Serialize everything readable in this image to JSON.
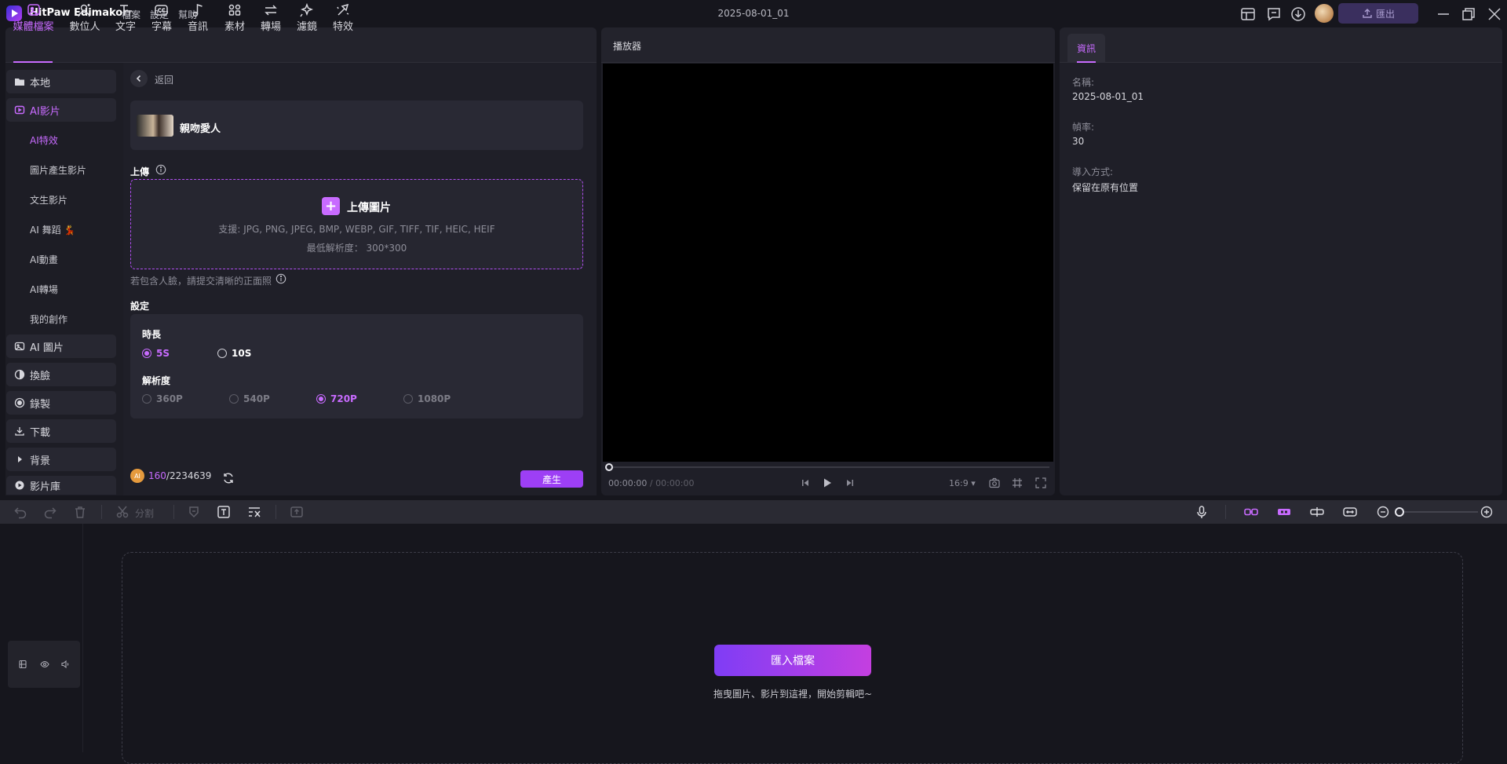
{
  "titlebar": {
    "app_name": "HitPaw Edimakor",
    "menus": [
      "檔案",
      "設定",
      "幫助"
    ],
    "project_title": "2025-08-01_01",
    "export_label": "匯出"
  },
  "toolbar": {
    "tabs": [
      {
        "label": "媒體檔案",
        "icon": "media-icon",
        "active": true
      },
      {
        "label": "數位人",
        "icon": "avatar-person-icon"
      },
      {
        "label": "文字",
        "icon": "text-icon"
      },
      {
        "label": "字幕",
        "icon": "subtitle-icon"
      },
      {
        "label": "音訊",
        "icon": "music-note-icon"
      },
      {
        "label": "素材",
        "icon": "assets-icon"
      },
      {
        "label": "轉場",
        "icon": "transition-icon"
      },
      {
        "label": "濾鏡",
        "icon": "filter-icon"
      },
      {
        "label": "特效",
        "icon": "effects-icon"
      }
    ]
  },
  "sidebar": {
    "items": [
      {
        "label": "本地",
        "icon": "folder-icon"
      },
      {
        "label": "AI影片",
        "icon": "ai-video-icon",
        "active": true
      },
      {
        "label": "AI 圖片",
        "icon": "ai-image-icon"
      },
      {
        "label": "換臉",
        "icon": "face-swap-icon"
      },
      {
        "label": "錄製",
        "icon": "record-icon"
      },
      {
        "label": "下載",
        "icon": "download-icon"
      },
      {
        "label": "背景",
        "icon": "caret-right-icon"
      },
      {
        "label": "影片庫",
        "icon": "video-library-icon"
      }
    ],
    "sub_items": [
      {
        "label": "AI特效",
        "active": true
      },
      {
        "label": "圖片產生影片"
      },
      {
        "label": "文生影片"
      },
      {
        "label": "AI 舞蹈 💃"
      },
      {
        "label": "AI動畫"
      },
      {
        "label": "AI轉場"
      },
      {
        "label": "我的創作"
      }
    ]
  },
  "content": {
    "back_label": "返回",
    "effect_name": "親吻愛人",
    "upload_heading": "上傳",
    "upload_button": "上傳圖片",
    "upload_formats": "支援: JPG, PNG, JPEG, BMP, WEBP, GIF, TIFF, TIF, HEIC, HEIF",
    "upload_min_res": "最低解析度： 300*300",
    "face_hint": "若包含人臉，請提交清晰的正面照",
    "settings_heading": "設定",
    "duration_label": "時長",
    "durations": [
      {
        "label": "5S",
        "selected": true
      },
      {
        "label": "10S",
        "selected": false
      }
    ],
    "resolution_label": "解析度",
    "resolutions": [
      {
        "label": "360P",
        "selected": false
      },
      {
        "label": "540P",
        "selected": false
      },
      {
        "label": "720P",
        "selected": true
      },
      {
        "label": "1080P",
        "selected": false
      }
    ],
    "credits_used": "160",
    "credits_total": "/2234639",
    "credit_badge": "AI",
    "generate_label": "產生"
  },
  "player": {
    "title": "播放器",
    "time_current": "00:00:00",
    "time_sep": " / ",
    "time_total": "00:00:00",
    "aspect_ratio": "16:9"
  },
  "info": {
    "tab_label": "資訊",
    "fields": [
      {
        "label": "名稱:",
        "value": "2025-08-01_01"
      },
      {
        "label": "幀率:",
        "value": "30"
      },
      {
        "label": "導入方式:",
        "value": "保留在原有位置"
      }
    ]
  },
  "timeline": {
    "split_label": "分割",
    "import_label": "匯入檔案",
    "drop_hint": "拖曳圖片、影片到這裡，開始剪輯吧~"
  },
  "colors": {
    "accent": "#c86bff",
    "generate": "#9d3ff5",
    "background": "#16161d",
    "panel": "#1f1f28"
  }
}
